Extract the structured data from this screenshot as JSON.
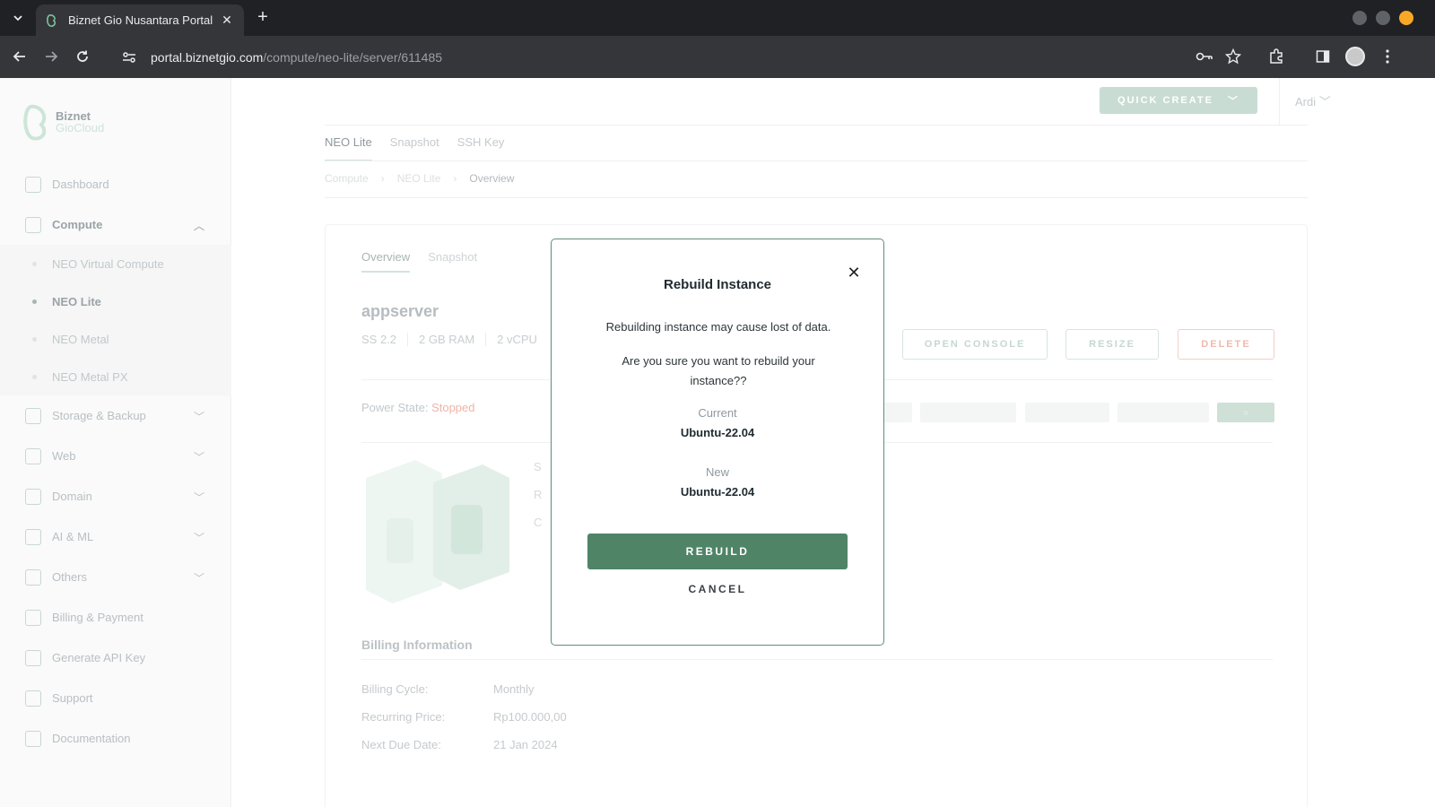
{
  "browser": {
    "tab_title": "Biznet Gio Nusantara Portal",
    "url_host": "portal.biznetgio.com",
    "url_path": "/compute/neo-lite/server/611485"
  },
  "sidebar": {
    "logo": {
      "line1": "Biznet",
      "line2": "GioCloud"
    },
    "items": [
      {
        "label": "Dashboard",
        "icon": "home-icon"
      },
      {
        "label": "Compute",
        "icon": "compute-icon",
        "expanded": true
      },
      {
        "label": "Storage & Backup",
        "icon": "storage-icon"
      },
      {
        "label": "Web",
        "icon": "web-icon"
      },
      {
        "label": "Domain",
        "icon": "domain-icon"
      },
      {
        "label": "AI & ML",
        "icon": "ai-icon"
      },
      {
        "label": "Others",
        "icon": "others-icon"
      },
      {
        "label": "Billing & Payment",
        "icon": "billing-icon"
      },
      {
        "label": "Generate API Key",
        "icon": "api-key-icon"
      },
      {
        "label": "Support",
        "icon": "support-icon"
      },
      {
        "label": "Documentation",
        "icon": "documentation-icon"
      }
    ],
    "compute_sub": [
      {
        "label": "NEO Virtual Compute",
        "active": false
      },
      {
        "label": "NEO Lite",
        "active": true
      },
      {
        "label": "NEO Metal",
        "active": false
      },
      {
        "label": "NEO Metal PX",
        "active": false
      }
    ]
  },
  "topbar": {
    "quick_create": "QUICK CREATE",
    "user": "Ardi"
  },
  "subtabs": [
    "NEO Lite",
    "Snapshot",
    "SSH Key"
  ],
  "breadcrumb": [
    "Compute",
    "NEO Lite",
    "Overview"
  ],
  "card": {
    "tabs": [
      "Overview",
      "Snapshot"
    ],
    "server_name": "appserver",
    "specs": [
      "SS 2.2",
      "2 GB RAM",
      "2 vCPU"
    ],
    "buttons": {
      "open_console": "OPEN CONSOLE",
      "resize": "RESIZE",
      "delete": "DELETE"
    },
    "power_label": "Power State:",
    "power_state": "Stopped",
    "partial_labels": [
      "S",
      "R",
      "C"
    ],
    "billing": {
      "title": "Billing Information",
      "rows": [
        {
          "key": "Billing Cycle:",
          "value": "Monthly"
        },
        {
          "key": "Recurring Price:",
          "value": "Rp100.000,00"
        },
        {
          "key": "Next Due Date:",
          "value": "21 Jan 2024"
        }
      ]
    }
  },
  "modal": {
    "title": "Rebuild Instance",
    "message1": "Rebuilding instance may cause lost of data.",
    "message2": "Are you sure you want to rebuild your instance??",
    "current_label": "Current",
    "current_value": "Ubuntu-22.04",
    "new_label": "New",
    "new_value": "Ubuntu-22.04",
    "rebuild_label": "REBUILD",
    "cancel_label": "CANCEL"
  },
  "colors": {
    "accent": "#4f8467",
    "modal_border": "#5f8f78",
    "stopped": "#f0b3a6"
  }
}
